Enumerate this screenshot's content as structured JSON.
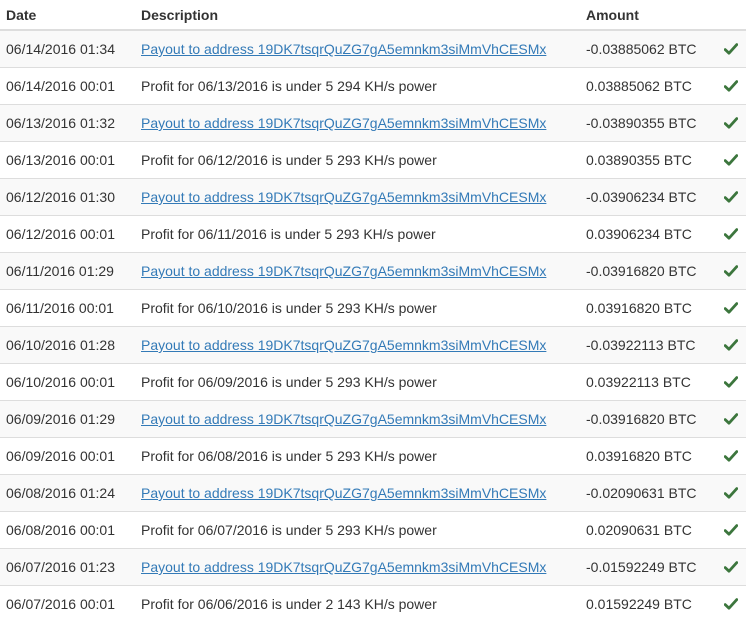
{
  "table": {
    "headers": {
      "date": "Date",
      "description": "Description",
      "amount": "Amount"
    },
    "status_icon": "check-icon",
    "status_color": "#3c763d",
    "link_color": "#337ab7",
    "rows": [
      {
        "date": "06/14/2016 01:34",
        "description": "Payout to address 19DK7tsqrQuZG7gA5emnkm3siMmVhCESMx",
        "is_link": true,
        "amount": "-0.03885062 BTC"
      },
      {
        "date": "06/14/2016 00:01",
        "description": "Profit for 06/13/2016 is under 5 294 KH/s power",
        "is_link": false,
        "amount": "0.03885062 BTC"
      },
      {
        "date": "06/13/2016 01:32",
        "description": "Payout to address 19DK7tsqrQuZG7gA5emnkm3siMmVhCESMx",
        "is_link": true,
        "amount": "-0.03890355 BTC"
      },
      {
        "date": "06/13/2016 00:01",
        "description": "Profit for 06/12/2016 is under 5 293 KH/s power",
        "is_link": false,
        "amount": "0.03890355 BTC"
      },
      {
        "date": "06/12/2016 01:30",
        "description": "Payout to address 19DK7tsqrQuZG7gA5emnkm3siMmVhCESMx",
        "is_link": true,
        "amount": "-0.03906234 BTC"
      },
      {
        "date": "06/12/2016 00:01",
        "description": "Profit for 06/11/2016 is under 5 293 KH/s power",
        "is_link": false,
        "amount": "0.03906234 BTC"
      },
      {
        "date": "06/11/2016 01:29",
        "description": "Payout to address 19DK7tsqrQuZG7gA5emnkm3siMmVhCESMx",
        "is_link": true,
        "amount": "-0.03916820 BTC"
      },
      {
        "date": "06/11/2016 00:01",
        "description": "Profit for 06/10/2016 is under 5 293 KH/s power",
        "is_link": false,
        "amount": "0.03916820 BTC"
      },
      {
        "date": "06/10/2016 01:28",
        "description": "Payout to address 19DK7tsqrQuZG7gA5emnkm3siMmVhCESMx",
        "is_link": true,
        "amount": "-0.03922113 BTC"
      },
      {
        "date": "06/10/2016 00:01",
        "description": "Profit for 06/09/2016 is under 5 293 KH/s power",
        "is_link": false,
        "amount": "0.03922113 BTC"
      },
      {
        "date": "06/09/2016 01:29",
        "description": "Payout to address 19DK7tsqrQuZG7gA5emnkm3siMmVhCESMx",
        "is_link": true,
        "amount": "-0.03916820 BTC"
      },
      {
        "date": "06/09/2016 00:01",
        "description": "Profit for 06/08/2016 is under 5 293 KH/s power",
        "is_link": false,
        "amount": "0.03916820 BTC"
      },
      {
        "date": "06/08/2016 01:24",
        "description": "Payout to address 19DK7tsqrQuZG7gA5emnkm3siMmVhCESMx",
        "is_link": true,
        "amount": "-0.02090631 BTC"
      },
      {
        "date": "06/08/2016 00:01",
        "description": "Profit for 06/07/2016 is under 5 293 KH/s power",
        "is_link": false,
        "amount": "0.02090631 BTC"
      },
      {
        "date": "06/07/2016 01:23",
        "description": "Payout to address 19DK7tsqrQuZG7gA5emnkm3siMmVhCESMx",
        "is_link": true,
        "amount": "-0.01592249 BTC"
      },
      {
        "date": "06/07/2016 00:01",
        "description": "Profit for 06/06/2016 is under 2 143 KH/s power",
        "is_link": false,
        "amount": "0.01592249 BTC"
      }
    ]
  }
}
